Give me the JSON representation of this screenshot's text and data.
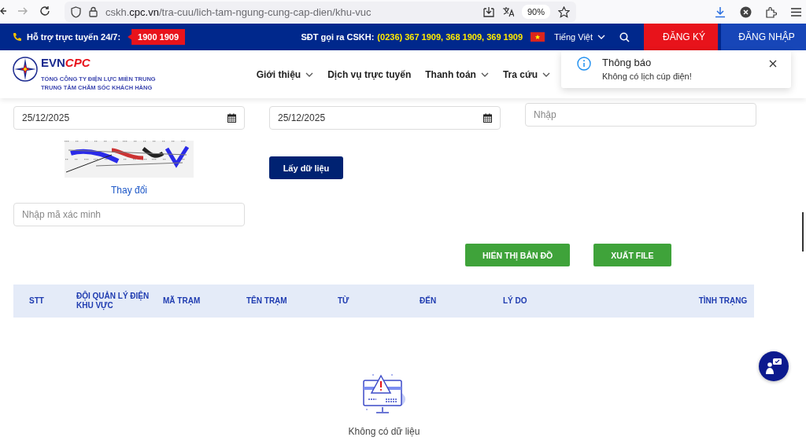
{
  "browser": {
    "url": "cskh.**cpc.vn**/tra-cuu/lich-tam-ngung-cung-cap-dien/khu-vuc",
    "zoom": "90%"
  },
  "top_bar": {
    "hotline_label": "Hỗ trợ trực tuyến 24/7:",
    "hotline": "1900 1909",
    "cskh_label": "SĐT gọi ra CSKH:",
    "cskh_numbers": "(0236) 367 1909, 368 1909, 369 1909",
    "language": "Tiếng Việt",
    "register": "ĐĂNG KÝ",
    "login": "ĐĂNG NHẬP"
  },
  "header": {
    "logo_1": "EVN",
    "logo_2": "CPC",
    "subtitle_1": "TỔNG CÔNG TY ĐIỆN LỰC MIỀN TRUNG",
    "subtitle_2": "TRUNG TÂM CHĂM SÓC KHÁCH HÀNG",
    "nav": [
      {
        "label": "Giới thiệu",
        "dropdown": true
      },
      {
        "label": "Dịch vụ trực tuyến",
        "dropdown": false
      },
      {
        "label": "Thanh toán",
        "dropdown": true
      },
      {
        "label": "Tra cứu",
        "dropdown": true
      }
    ]
  },
  "toast": {
    "title": "Thông báo",
    "message": "Không có lịch cúp điện!"
  },
  "form": {
    "from_date": "25/12/2025",
    "to_date": "25/12/2025",
    "station_placeholder": "Nhập",
    "captcha_refresh": "Thay đổi",
    "captcha_placeholder": "Nhập mã xác minh",
    "submit": "Lấy dữ liệu"
  },
  "actions": [
    "HIỂN THỊ BẢN ĐỒ",
    "XUẤT FILE"
  ],
  "table": {
    "columns": [
      "STT",
      "ĐỘI QUẢN LÝ ĐIỆN KHU VỰC",
      "MÃ TRẠM",
      "TÊN TRẠM",
      "TỪ",
      "ĐẾN",
      "LÝ DO",
      "TÌNH TRẠNG"
    ],
    "empty": "Không có dữ liệu"
  }
}
